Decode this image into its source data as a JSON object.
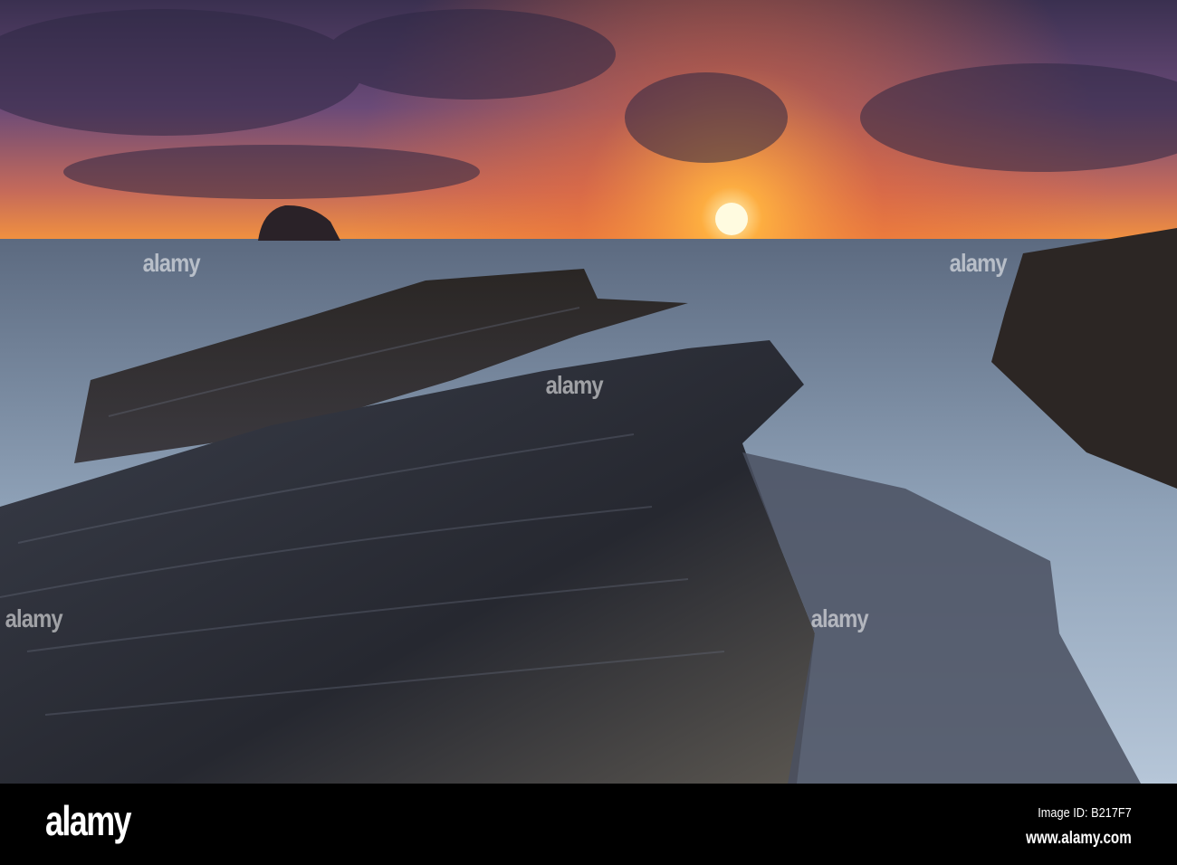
{
  "photo": {
    "subject": "sunset over rocky coastline",
    "watermark": "alamy"
  },
  "footer": {
    "logo": "alamy",
    "image_id": "Image ID: B217F7",
    "url": "www.alamy.com"
  }
}
